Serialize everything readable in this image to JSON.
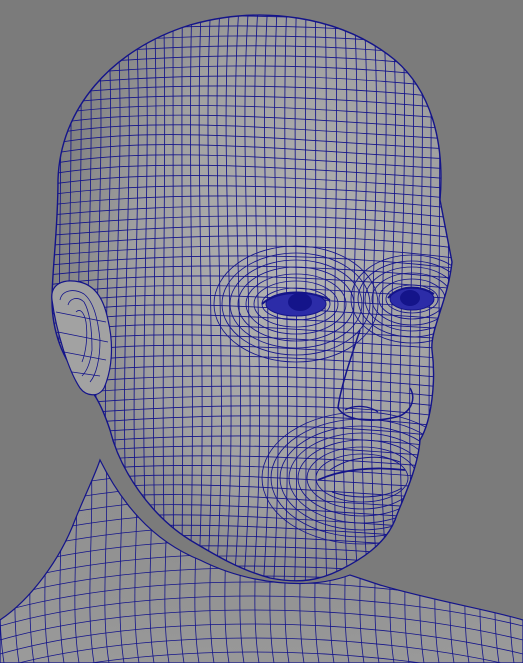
{
  "viewport": {
    "background_color": "#7b7b7b",
    "mesh": {
      "name": "head-mesh",
      "display_mode": "wireframe-on-shaded",
      "surface_color": "#9a9a9a",
      "wire_color": "#14148a"
    }
  }
}
